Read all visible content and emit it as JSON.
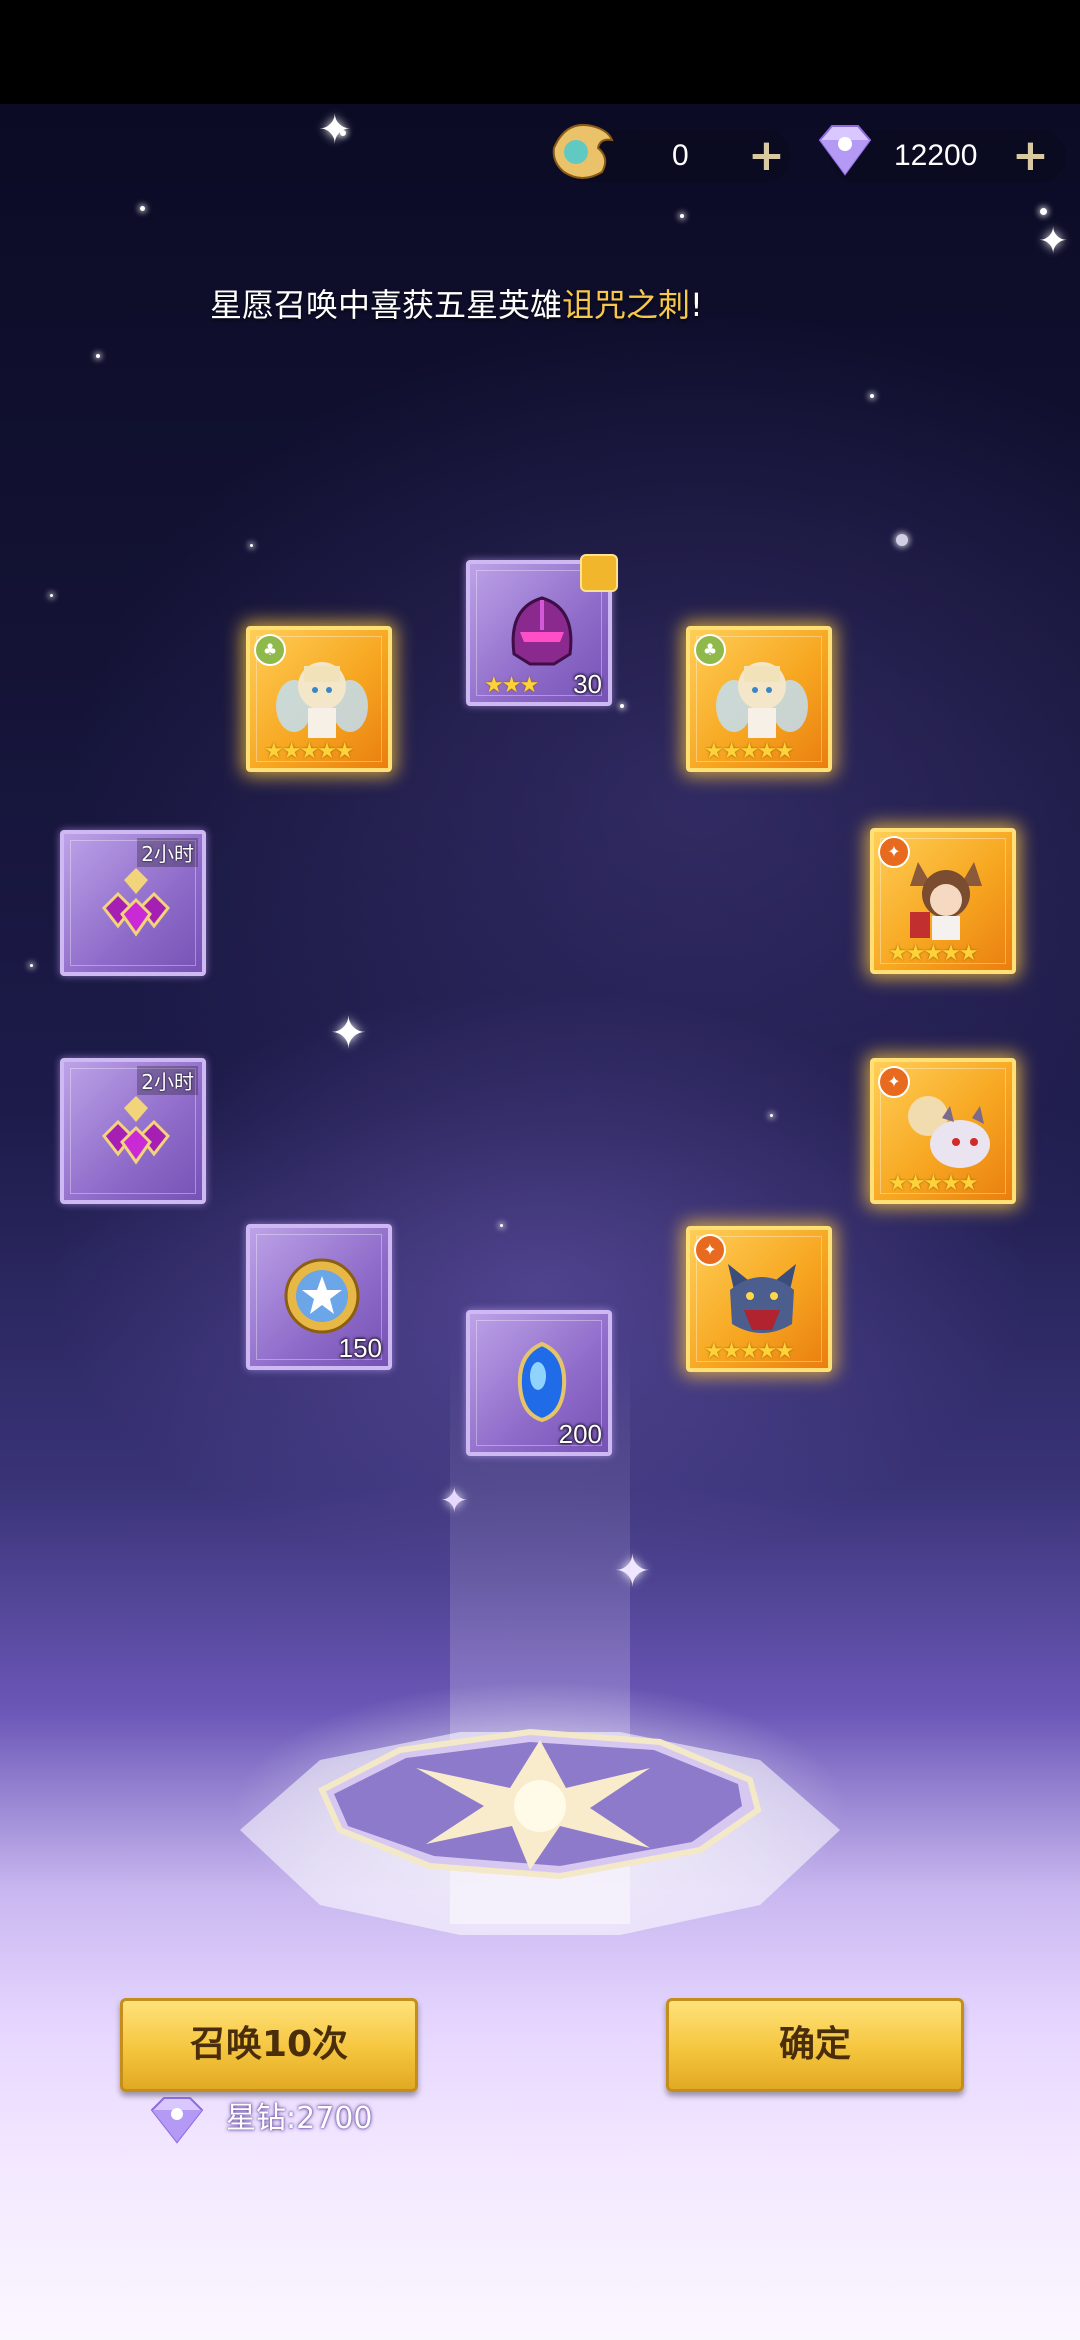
{
  "currency": {
    "spirit_count": "0",
    "diamond_count": "12200",
    "plus_label": "+"
  },
  "announcement": {
    "prefix": "星愿召唤中喜获五星英雄",
    "hero_name": "诅咒之刺",
    "suffix": "!"
  },
  "rewards": [
    {
      "kind": "item",
      "name": "helmet",
      "quantity": "30",
      "stars": "★★★",
      "rarity": "purple"
    },
    {
      "kind": "hero",
      "name": "fairy-hero",
      "stars": "★★★★★",
      "rarity": "gold"
    },
    {
      "kind": "hero",
      "name": "fairy-hero",
      "stars": "★★★★★",
      "rarity": "gold"
    },
    {
      "kind": "item",
      "name": "potion-pack",
      "time_label": "2小时",
      "rarity": "purple"
    },
    {
      "kind": "hero",
      "name": "fox-girl-hero",
      "stars": "★★★★★",
      "rarity": "gold"
    },
    {
      "kind": "item",
      "name": "potion-pack",
      "time_label": "2小时",
      "rarity": "purple"
    },
    {
      "kind": "hero",
      "name": "beast-rider-hero",
      "stars": "★★★★★",
      "rarity": "gold"
    },
    {
      "kind": "item",
      "name": "star-coin",
      "quantity": "150",
      "rarity": "purple"
    },
    {
      "kind": "hero",
      "name": "wolf-hero",
      "stars": "★★★★★",
      "rarity": "gold"
    },
    {
      "kind": "item",
      "name": "blue-crystal",
      "quantity": "200",
      "rarity": "purple"
    }
  ],
  "buttons": {
    "summon_ten": "召唤10次",
    "confirm": "确定"
  },
  "cost": {
    "label": "星钻:2700"
  },
  "colors": {
    "gold_card": "#f7a721",
    "purple_card": "#8e6bc9",
    "button": "#f5c53e",
    "highlight_text": "#f7c84a"
  }
}
